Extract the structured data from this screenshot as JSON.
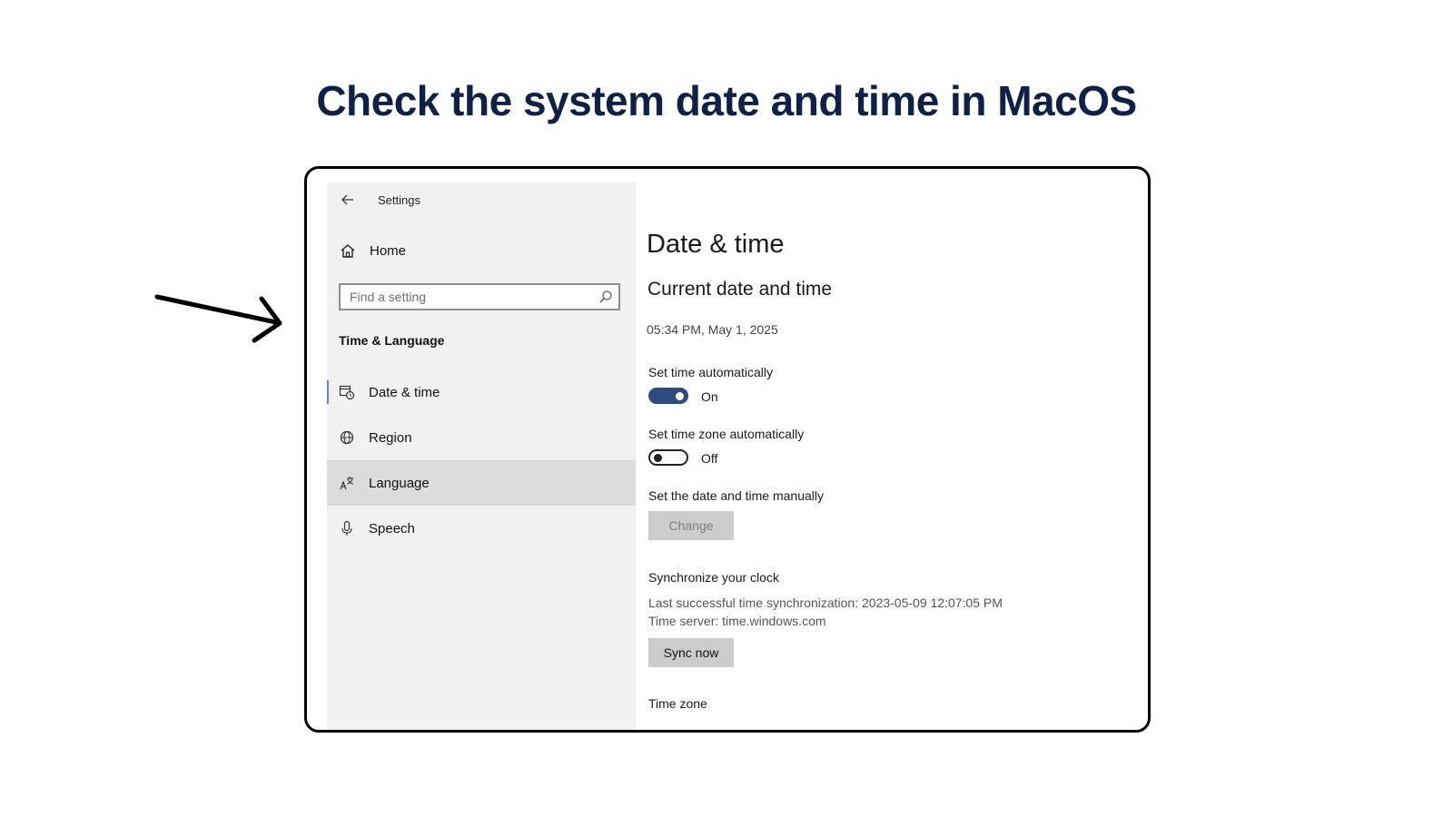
{
  "slide": {
    "title": "Check the system date and time in MacOS"
  },
  "window": {
    "title": "Settings"
  },
  "sidebar": {
    "home_label": "Home",
    "search": {
      "placeholder": "Find a setting",
      "value": ""
    },
    "section_title": "Time & Language",
    "items": [
      {
        "label": "Date & time",
        "icon": "calendar-clock-icon",
        "state": "selected"
      },
      {
        "label": "Region",
        "icon": "globe-icon"
      },
      {
        "label": "Language",
        "icon": "language-icon",
        "state": "hover"
      },
      {
        "label": "Speech",
        "icon": "microphone-icon"
      }
    ]
  },
  "main": {
    "title": "Date & time",
    "current_section": "Current date and time",
    "current_value": "05:34 PM, May 1, 2025",
    "set_time_auto": {
      "label": "Set time automatically",
      "state": "On",
      "on": true
    },
    "set_tz_auto": {
      "label": "Set time zone automatically",
      "state": "Off",
      "on": false
    },
    "manual": {
      "label": "Set the date and time manually",
      "button": "Change"
    },
    "sync": {
      "title": "Synchronize your clock",
      "last_sync": "Last successful time synchronization: 2023-05-09 12:07:05 PM",
      "server": "Time server: time.windows.com",
      "button": "Sync now"
    },
    "timezone": {
      "label": "Time zone"
    }
  },
  "colors": {
    "toggle_on": "#2f4a7c",
    "title": "#0f2147",
    "sidebar_bg": "#f1f1f1",
    "hover_bg": "#dcdcdc"
  }
}
